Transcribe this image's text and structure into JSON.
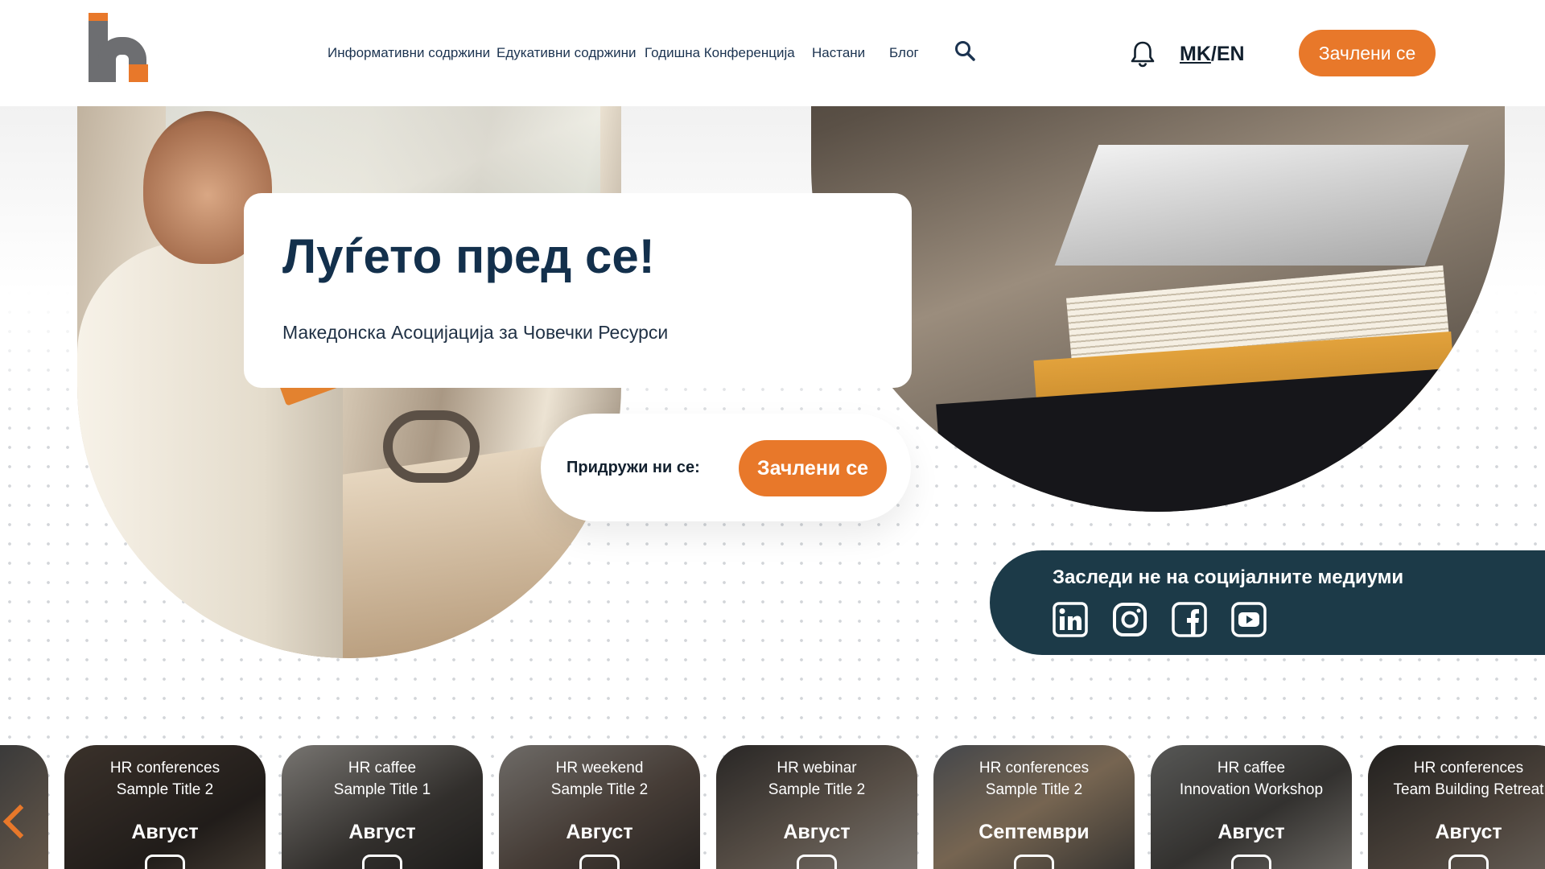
{
  "header": {
    "nav": [
      {
        "label": "Информативни содржини"
      },
      {
        "label": "Едукативни содржини"
      },
      {
        "label": "Годишна Конференција"
      },
      {
        "label": "Настани"
      },
      {
        "label": "Блог"
      }
    ],
    "lang_mk": "MK",
    "lang_sep": "/",
    "lang_en": "EN",
    "join_label": "Зачлени се",
    "icons": {
      "search": "search-icon",
      "notifications": "bell-icon"
    }
  },
  "hero": {
    "title": "Луѓето пред се!",
    "subtitle": "Македонска Асоцијација за Човечки Ресурси",
    "join_prompt": "Придружи ни се:",
    "join_button": "Зачлени се"
  },
  "social": {
    "title": "Заследи не на социјалните медиуми",
    "icons": [
      "linkedin-icon",
      "instagram-icon",
      "facebook-icon",
      "youtube-icon"
    ]
  },
  "events": [
    {
      "category": "HR conferences",
      "title": "Sample Title 2",
      "month": "Август"
    },
    {
      "category": "HR caffee",
      "title": "Sample Title 1",
      "month": "Август"
    },
    {
      "category": "HR weekend",
      "title": "Sample Title 2",
      "month": "Август"
    },
    {
      "category": "HR webinar",
      "title": "Sample Title 2",
      "month": "Август"
    },
    {
      "category": "HR conferences",
      "title": "Sample Title 2",
      "month": "Септември"
    },
    {
      "category": "HR caffee",
      "title": "Innovation Workshop",
      "month": "Август"
    },
    {
      "category": "HR conferences",
      "title": "Team Building Retreat",
      "month": "Август"
    }
  ],
  "colors": {
    "accent": "#e8782a",
    "navy": "#13304c",
    "social_bg": "#1c3a48"
  }
}
